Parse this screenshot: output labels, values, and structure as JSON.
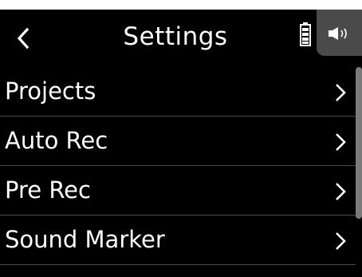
{
  "header": {
    "title": "Settings",
    "back_icon": "chevron-left-icon",
    "battery_icon": "battery-full-icon",
    "speaker_icon": "speaker-volume-icon"
  },
  "menu": {
    "items": [
      {
        "label": "Projects",
        "icon": "chevron-right-icon"
      },
      {
        "label": "Auto Rec",
        "icon": "chevron-right-icon"
      },
      {
        "label": "Pre Rec",
        "icon": "chevron-right-icon"
      },
      {
        "label": "Sound Marker",
        "icon": "chevron-right-icon"
      }
    ]
  },
  "colors": {
    "background": "#000000",
    "text": "#ffffff",
    "divider": "#4a4a4a",
    "tab": "#4a4a4a",
    "scrollbar": "#7a7a7a"
  }
}
